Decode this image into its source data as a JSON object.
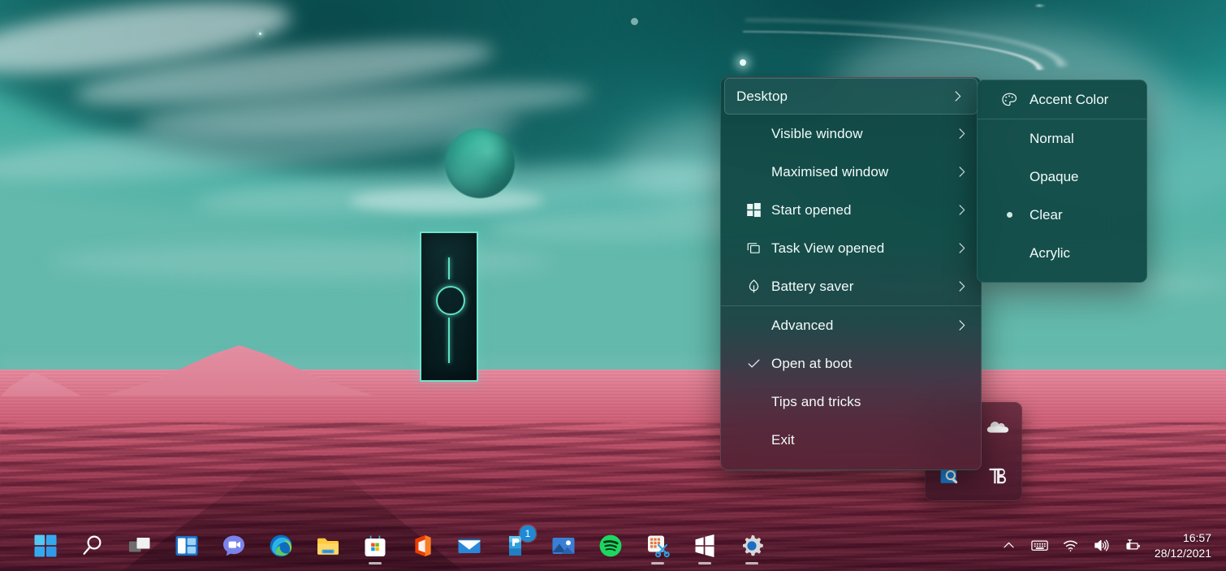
{
  "desktop": {
    "wallpaper_name": "alien-landscape-wallpaper",
    "colors": {
      "sky_teal": "#1f8a87",
      "ground_pink": "#d86f86",
      "ground_dark": "#4a1428",
      "monolith_glow": "#5fe0c6",
      "menu_bg": "#0d4240",
      "submenu_bg": "#114a47",
      "accent_blue": "#1e8ad6"
    }
  },
  "context_menu": {
    "name": "TranslucentTB tray context menu",
    "items": [
      {
        "label": "Desktop",
        "icon": "none",
        "chevron": "›",
        "selected": true,
        "checked": false
      },
      {
        "label": "Visible window",
        "icon": "none",
        "chevron": "›",
        "selected": false,
        "checked": false
      },
      {
        "label": "Maximised window",
        "icon": "none",
        "chevron": "›",
        "selected": false,
        "checked": false
      },
      {
        "label": "Start opened",
        "icon": "windows-icon",
        "chevron": "›",
        "selected": false,
        "checked": false
      },
      {
        "label": "Task View opened",
        "icon": "taskview-icon",
        "chevron": "›",
        "selected": false,
        "checked": false
      },
      {
        "label": "Battery saver",
        "icon": "leaf-icon",
        "chevron": "›",
        "selected": false,
        "checked": false
      },
      {
        "label": "Advanced",
        "icon": "none",
        "chevron": "›",
        "selected": false,
        "checked": false
      },
      {
        "label": "Open at boot",
        "icon": "check-icon",
        "chevron": "",
        "selected": false,
        "checked": true
      },
      {
        "label": "Tips and tricks",
        "icon": "none",
        "chevron": "",
        "selected": false,
        "checked": false
      },
      {
        "label": "Exit",
        "icon": "none",
        "chevron": "",
        "selected": false,
        "checked": false
      }
    ],
    "separator_after_index": 5
  },
  "submenu": {
    "name": "Desktop appearance submenu",
    "header": {
      "label": "Accent Color",
      "icon": "palette-icon"
    },
    "options": [
      {
        "label": "Normal",
        "selected": false
      },
      {
        "label": "Opaque",
        "selected": false
      },
      {
        "label": "Clear",
        "selected": true
      },
      {
        "label": "Acrylic",
        "selected": false
      }
    ]
  },
  "tray_flyout": {
    "name": "hidden-icons-flyout",
    "icons": [
      {
        "name": "onedrive-icon",
        "label": "OneDrive"
      },
      {
        "name": "search-indexer-icon",
        "label": "Search"
      },
      {
        "name": "translucenttb-icon",
        "label": "TB"
      }
    ]
  },
  "taskbar": {
    "buttons": [
      {
        "name": "start-button",
        "label": "Start",
        "running": false,
        "badge": ""
      },
      {
        "name": "search-button",
        "label": "Search",
        "running": false,
        "badge": ""
      },
      {
        "name": "task-view-button",
        "label": "Task View",
        "running": false,
        "badge": ""
      },
      {
        "name": "widgets-button",
        "label": "Widgets",
        "running": false,
        "badge": ""
      },
      {
        "name": "chat-button",
        "label": "Chat",
        "running": false,
        "badge": ""
      },
      {
        "name": "edge-button",
        "label": "Microsoft Edge",
        "running": false,
        "badge": ""
      },
      {
        "name": "file-explorer-button",
        "label": "File Explorer",
        "running": false,
        "badge": ""
      },
      {
        "name": "microsoft-store-button",
        "label": "Microsoft Store",
        "running": true,
        "badge": ""
      },
      {
        "name": "office-button",
        "label": "Office",
        "running": false,
        "badge": ""
      },
      {
        "name": "mail-button",
        "label": "Mail",
        "running": false,
        "badge": ""
      },
      {
        "name": "todo-button",
        "label": "To Do",
        "running": false,
        "badge": "1"
      },
      {
        "name": "photos-button",
        "label": "Photos",
        "running": false,
        "badge": ""
      },
      {
        "name": "spotify-button",
        "label": "Spotify",
        "running": false,
        "badge": ""
      },
      {
        "name": "snipping-tool-button",
        "label": "Snipping Tool",
        "running": true,
        "badge": ""
      },
      {
        "name": "windows-app-button",
        "label": "Windows",
        "running": true,
        "badge": ""
      },
      {
        "name": "settings-button",
        "label": "Settings",
        "running": true,
        "badge": ""
      }
    ],
    "tray": [
      {
        "name": "show-hidden-icons-button",
        "label": "Show hidden icons"
      },
      {
        "name": "touch-keyboard-button",
        "label": "Touch keyboard"
      },
      {
        "name": "network-button",
        "label": "Network"
      },
      {
        "name": "volume-button",
        "label": "Volume"
      },
      {
        "name": "battery-button",
        "label": "Battery charging"
      }
    ],
    "clock": {
      "time": "16:57",
      "date": "28/12/2021"
    }
  }
}
